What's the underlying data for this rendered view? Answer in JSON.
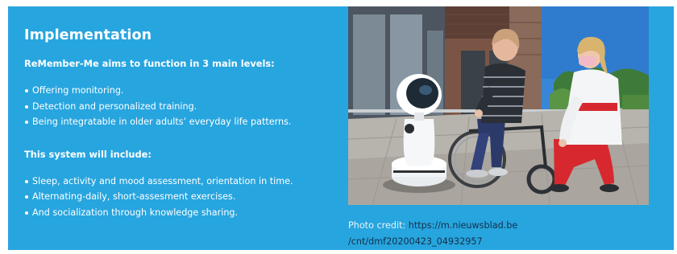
{
  "section": {
    "title": "Implementation",
    "intro": "ReMember-Me aims to function in 3 main levels:",
    "levels": [
      "Offering monitoring.",
      "Detection and personalized training.",
      "Being integratable in older adults’ everyday life patterns."
    ],
    "includes_heading": "This system will include:",
    "includes": [
      "Sleep, activity and mood assessment, orientation in time.",
      "Alternating-daily, short-assesment exercises.",
      "And socialization through knowledge sharing."
    ]
  },
  "photo": {
    "subject": "robot, older woman in wheelchair and nurse on a terrace",
    "credit_label": "Photo credit:",
    "credit_url_line1": "https://m.nieuwsblad.be",
    "credit_url_line2": "/cnt/dmf20200423_04932957"
  },
  "colors": {
    "panel_background": "#27a5df",
    "text": "#ffffff"
  }
}
